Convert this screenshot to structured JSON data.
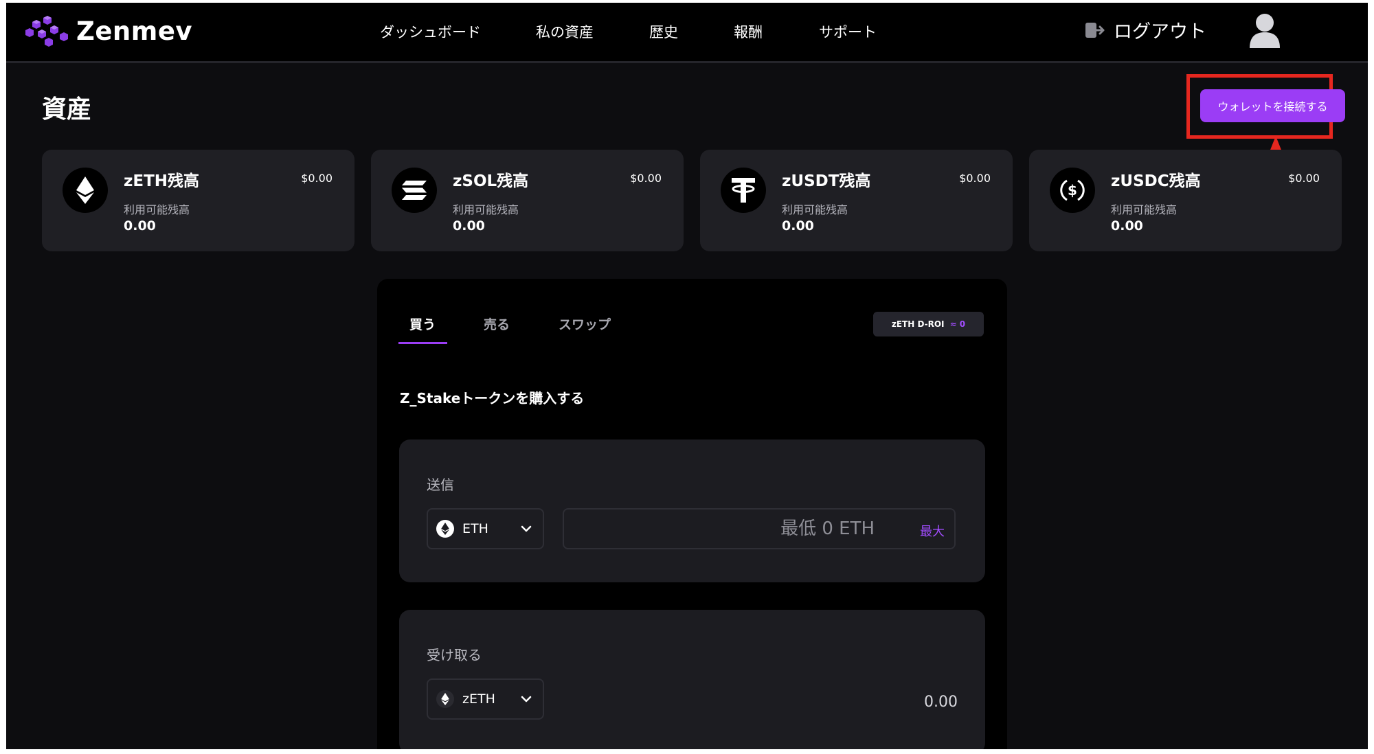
{
  "brand": {
    "name": "Zenmev",
    "accent": "#9b3df5"
  },
  "nav": {
    "dashboard": "ダッシュボード",
    "my_assets": "私の資産",
    "history": "歴史",
    "rewards": "報酬",
    "support": "サポート"
  },
  "header": {
    "logout_label": "ログアウト",
    "logout_icon": "logout-icon",
    "avatar_icon": "user-icon"
  },
  "page": {
    "title": "資産",
    "connect_wallet_label": "ウォレットを接続する"
  },
  "balances": [
    {
      "title": "zETH残高",
      "usd": "$0.00",
      "label": "利用可能残高",
      "value": "0.00",
      "icon": "ethereum-icon"
    },
    {
      "title": "zSOL残高",
      "usd": "$0.00",
      "label": "利用可能残高",
      "value": "0.00",
      "icon": "solana-icon"
    },
    {
      "title": "zUSDT残高",
      "usd": "$0.00",
      "label": "利用可能残高",
      "value": "0.00",
      "icon": "tether-icon"
    },
    {
      "title": "zUSDC残高",
      "usd": "$0.00",
      "label": "利用可能残高",
      "value": "0.00",
      "icon": "usdc-icon"
    }
  ],
  "trade": {
    "tabs": {
      "buy": "買う",
      "sell": "売る",
      "swap": "スワップ"
    },
    "roi_label": "zETH D-ROI",
    "roi_value": "≈ 0",
    "section_title": "Z_Stakeトークンを購入する",
    "send": {
      "label": "送信",
      "token": "ETH",
      "amount_placeholder": "最低 0 ETH",
      "max_label": "最大"
    },
    "receive": {
      "label": "受け取る",
      "token": "zETH",
      "value": "0.00"
    }
  }
}
